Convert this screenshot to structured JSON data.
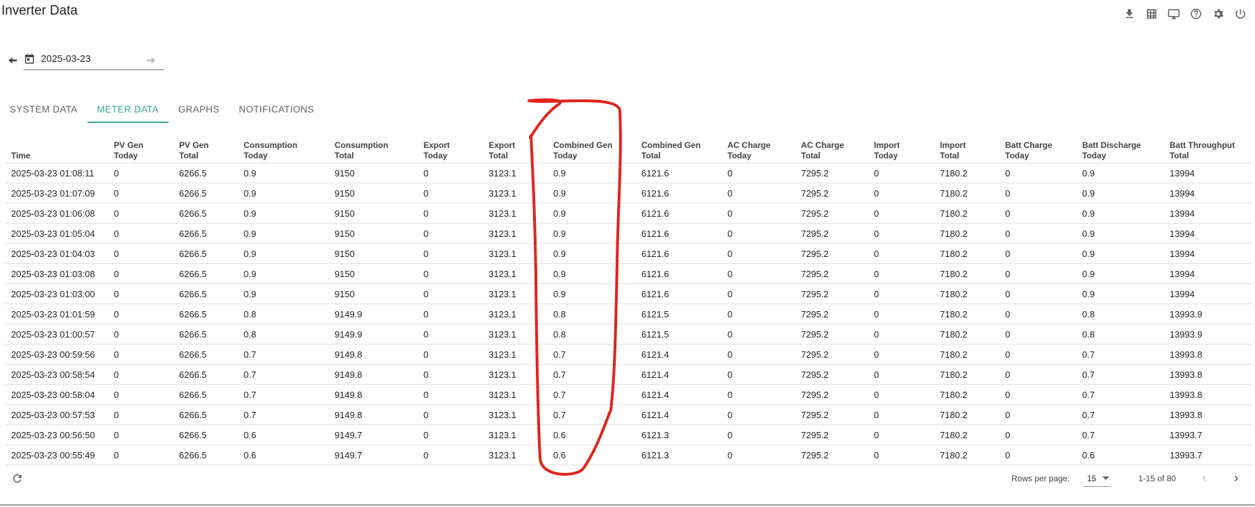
{
  "header": {
    "title": "Inverter Data"
  },
  "toolbar": {
    "icons": [
      "download-icon",
      "grid-icon",
      "monitor-icon",
      "help-icon",
      "settings-icon",
      "power-icon"
    ]
  },
  "date_nav": {
    "date": "2025-03-23"
  },
  "tabs": [
    {
      "label": "SYSTEM DATA",
      "active": false
    },
    {
      "label": "METER DATA",
      "active": true
    },
    {
      "label": "GRAPHS",
      "active": false
    },
    {
      "label": "NOTIFICATIONS",
      "active": false
    }
  ],
  "table": {
    "columns": [
      "Time",
      "PV Gen\nToday",
      "PV Gen\nTotal",
      "Consumption\nToday",
      "Consumption\nTotal",
      "Export\nToday",
      "Export\nTotal",
      "Combined Gen\nToday",
      "Combined Gen\nTotal",
      "AC Charge\nToday",
      "AC Charge\nTotal",
      "Import\nToday",
      "Import\nTotal",
      "Batt Charge\nToday",
      "Batt Discharge\nToday",
      "Batt Throughput\nTotal"
    ],
    "rows": [
      [
        "2025-03-23 01:08:11",
        "0",
        "6266.5",
        "0.9",
        "9150",
        "0",
        "3123.1",
        "0.9",
        "6121.6",
        "0",
        "7295.2",
        "0",
        "7180.2",
        "0",
        "0.9",
        "13994"
      ],
      [
        "2025-03-23 01:07:09",
        "0",
        "6266.5",
        "0.9",
        "9150",
        "0",
        "3123.1",
        "0.9",
        "6121.6",
        "0",
        "7295.2",
        "0",
        "7180.2",
        "0",
        "0.9",
        "13994"
      ],
      [
        "2025-03-23 01:06:08",
        "0",
        "6266.5",
        "0.9",
        "9150",
        "0",
        "3123.1",
        "0.9",
        "6121.6",
        "0",
        "7295.2",
        "0",
        "7180.2",
        "0",
        "0.9",
        "13994"
      ],
      [
        "2025-03-23 01:05:04",
        "0",
        "6266.5",
        "0.9",
        "9150",
        "0",
        "3123.1",
        "0.9",
        "6121.6",
        "0",
        "7295.2",
        "0",
        "7180.2",
        "0",
        "0.9",
        "13994"
      ],
      [
        "2025-03-23 01:04:03",
        "0",
        "6266.5",
        "0.9",
        "9150",
        "0",
        "3123.1",
        "0.9",
        "6121.6",
        "0",
        "7295.2",
        "0",
        "7180.2",
        "0",
        "0.9",
        "13994"
      ],
      [
        "2025-03-23 01:03:08",
        "0",
        "6266.5",
        "0.9",
        "9150",
        "0",
        "3123.1",
        "0.9",
        "6121.6",
        "0",
        "7295.2",
        "0",
        "7180.2",
        "0",
        "0.9",
        "13994"
      ],
      [
        "2025-03-23 01:03:00",
        "0",
        "6266.5",
        "0.9",
        "9150",
        "0",
        "3123.1",
        "0.9",
        "6121.6",
        "0",
        "7295.2",
        "0",
        "7180.2",
        "0",
        "0.9",
        "13994"
      ],
      [
        "2025-03-23 01:01:59",
        "0",
        "6266.5",
        "0.8",
        "9149.9",
        "0",
        "3123.1",
        "0.8",
        "6121.5",
        "0",
        "7295.2",
        "0",
        "7180.2",
        "0",
        "0.8",
        "13993.9"
      ],
      [
        "2025-03-23 01:00:57",
        "0",
        "6266.5",
        "0.8",
        "9149.9",
        "0",
        "3123.1",
        "0.8",
        "6121.5",
        "0",
        "7295.2",
        "0",
        "7180.2",
        "0",
        "0.8",
        "13993.9"
      ],
      [
        "2025-03-23 00:59:56",
        "0",
        "6266.5",
        "0.7",
        "9149.8",
        "0",
        "3123.1",
        "0.7",
        "6121.4",
        "0",
        "7295.2",
        "0",
        "7180.2",
        "0",
        "0.7",
        "13993.8"
      ],
      [
        "2025-03-23 00:58:54",
        "0",
        "6266.5",
        "0.7",
        "9149.8",
        "0",
        "3123.1",
        "0.7",
        "6121.4",
        "0",
        "7295.2",
        "0",
        "7180.2",
        "0",
        "0.7",
        "13993.8"
      ],
      [
        "2025-03-23 00:58:04",
        "0",
        "6266.5",
        "0.7",
        "9149.8",
        "0",
        "3123.1",
        "0.7",
        "6121.4",
        "0",
        "7295.2",
        "0",
        "7180.2",
        "0",
        "0.7",
        "13993.8"
      ],
      [
        "2025-03-23 00:57:53",
        "0",
        "6266.5",
        "0.7",
        "9149.8",
        "0",
        "3123.1",
        "0.7",
        "6121.4",
        "0",
        "7295.2",
        "0",
        "7180.2",
        "0",
        "0.7",
        "13993.8"
      ],
      [
        "2025-03-23 00:56:50",
        "0",
        "6266.5",
        "0.6",
        "9149.7",
        "0",
        "3123.1",
        "0.6",
        "6121.3",
        "0",
        "7295.2",
        "0",
        "7180.2",
        "0",
        "0.7",
        "13993.7"
      ],
      [
        "2025-03-23 00:55:49",
        "0",
        "6266.5",
        "0.6",
        "9149.7",
        "0",
        "3123.1",
        "0.6",
        "6121.3",
        "0",
        "7295.2",
        "0",
        "7180.2",
        "0",
        "0.6",
        "13993.7"
      ]
    ]
  },
  "footer": {
    "rows_per_page_label": "Rows per page:",
    "rows_per_page_value": "15",
    "range_text": "1-15 of 80"
  },
  "colors": {
    "accent": "#3aa595",
    "annotation": "#e0241a"
  }
}
